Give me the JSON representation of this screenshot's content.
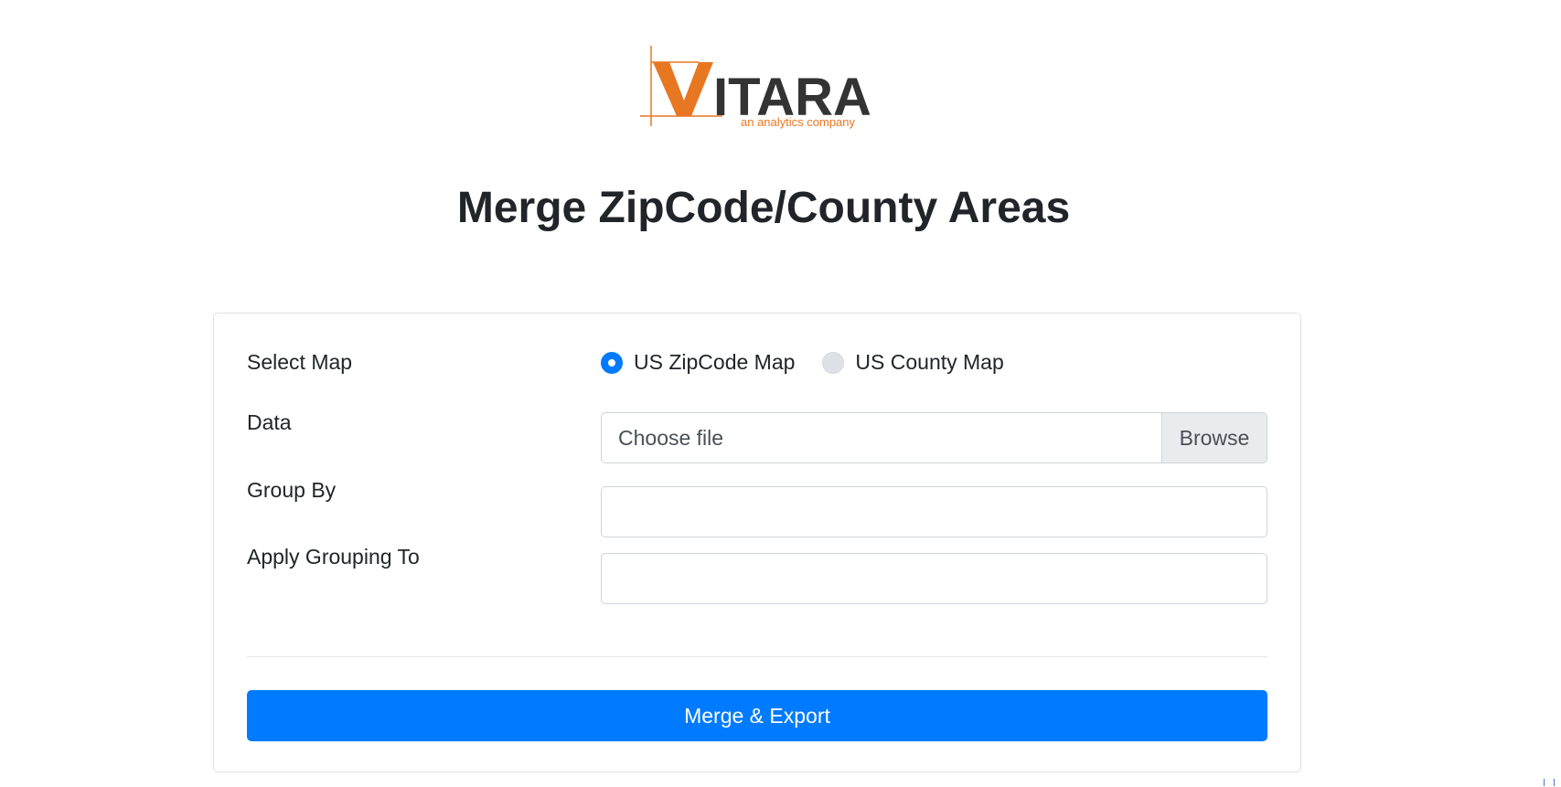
{
  "logo": {
    "brand": "VITARA",
    "tagline": "an analytics company",
    "colors": {
      "accent": "#e87722",
      "dark": "#333333"
    }
  },
  "page_title": "Merge ZipCode/County Areas",
  "form": {
    "select_map": {
      "label": "Select Map",
      "options": [
        {
          "label": "US ZipCode Map",
          "checked": true
        },
        {
          "label": "US County Map",
          "checked": false
        }
      ]
    },
    "data": {
      "label": "Data",
      "placeholder": "Choose file",
      "browse_label": "Browse"
    },
    "group_by": {
      "label": "Group By",
      "value": ""
    },
    "apply_grouping_to": {
      "label": "Apply Grouping To",
      "value": ""
    },
    "submit_label": "Merge & Export"
  },
  "colors": {
    "primary": "#007bff",
    "text": "#212529",
    "border": "#ced4da"
  }
}
